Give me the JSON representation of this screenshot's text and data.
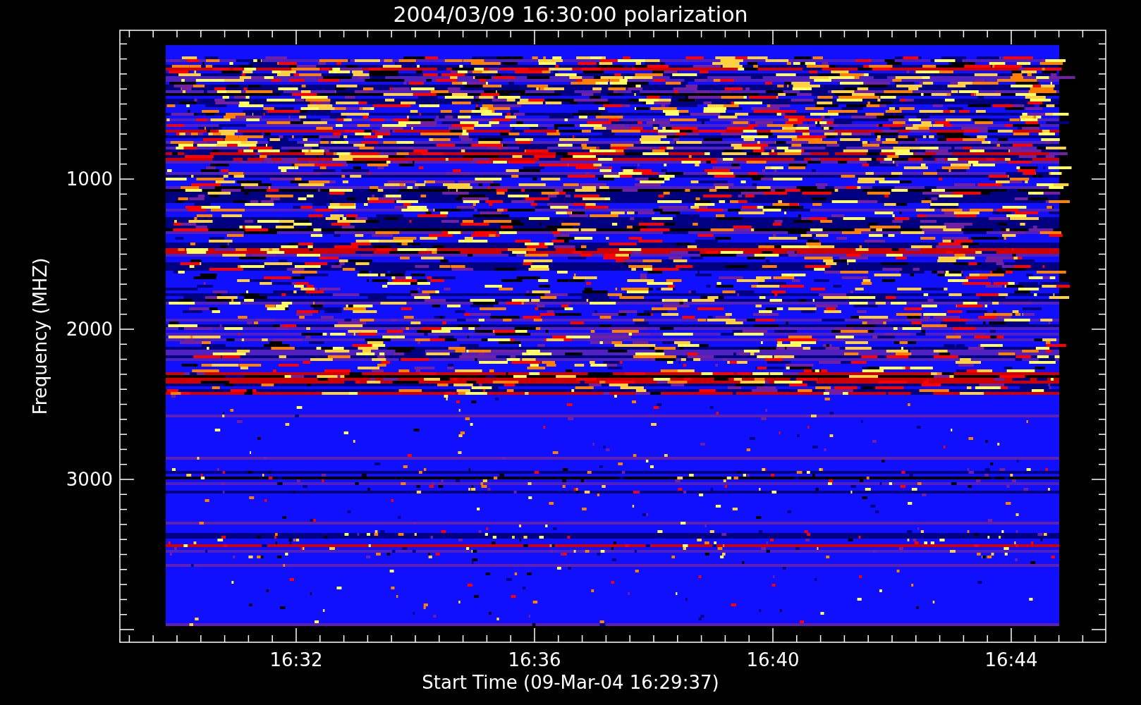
{
  "title": "2004/03/09 16:30:00 polarization",
  "y_axis": {
    "label": "Frequency (MHZ)",
    "tick_labels": [
      "1000",
      "2000",
      "3000"
    ]
  },
  "x_axis": {
    "label": "Start Time (09-Mar-04 16:29:37)",
    "tick_labels": [
      "16:32",
      "16:36",
      "16:40",
      "16:44"
    ]
  }
}
